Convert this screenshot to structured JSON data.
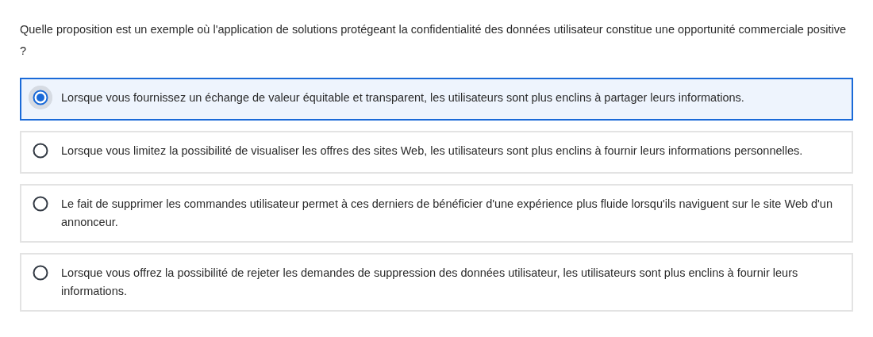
{
  "question": "Quelle proposition est un exemple où l'application de solutions protégeant la confidentialité des données utilisateur constitue une opportunité commerciale positive ?",
  "options": [
    {
      "label": "Lorsque vous fournissez un échange de valeur équitable et transparent, les utilisateurs sont plus enclins à partager leurs informations.",
      "selected": true
    },
    {
      "label": "Lorsque vous limitez la possibilité de visualiser les offres des sites Web, les utilisateurs sont plus enclins à fournir leurs informations personnelles.",
      "selected": false
    },
    {
      "label": "Le fait de supprimer les commandes utilisateur permet à ces derniers de bénéficier d'une expérience plus fluide lorsqu'ils naviguent sur le site Web d'un annonceur.",
      "selected": false
    },
    {
      "label": "Lorsque vous offrez la possibilité de rejeter les demandes de suppression des données utilisateur, les utilisateurs sont plus enclins à fournir leurs informations.",
      "selected": false
    }
  ]
}
